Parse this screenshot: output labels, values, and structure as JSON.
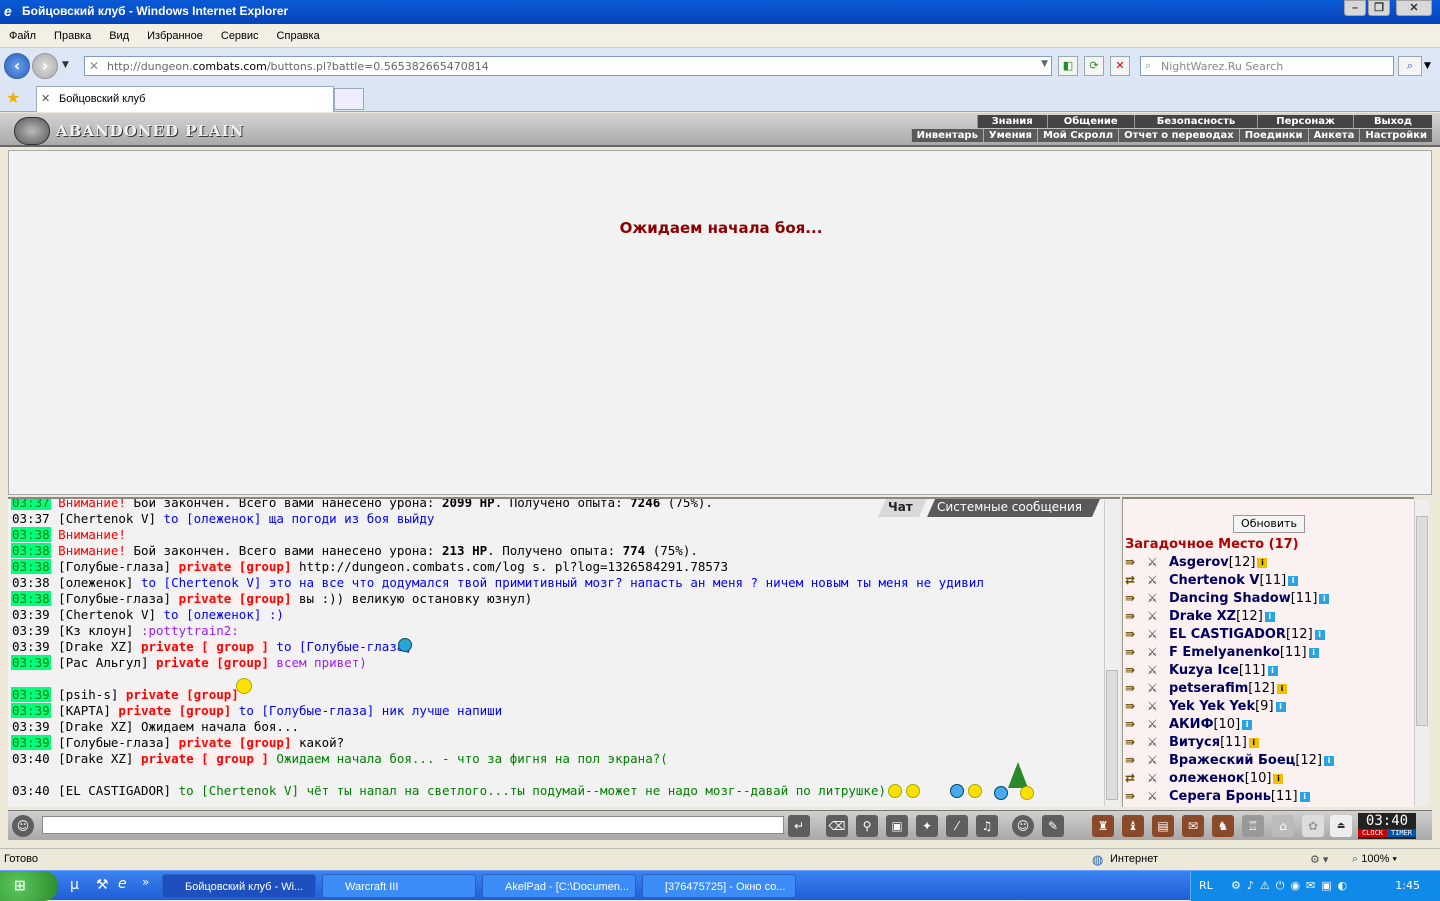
{
  "window": {
    "title": "Бойцовский клуб - Windows Internet Explorer",
    "controls": [
      "–",
      "❐",
      "✕"
    ]
  },
  "menu": [
    "Файл",
    "Правка",
    "Вид",
    "Избранное",
    "Сервис",
    "Справка"
  ],
  "address": {
    "url_prefix": "http://dungeon.",
    "url_domain": "combats.com",
    "url_suffix": "/buttons.pl?battle=0.565382665470814",
    "search_placeholder": "NightWarez.Ru Search"
  },
  "tabs": [
    {
      "label": "Бойцовский клуб"
    }
  ],
  "game": {
    "logo": "ABANDONED PLAIN",
    "top_menu": [
      "Знания",
      "Общение",
      "Безопасность",
      "Персонаж",
      "Выход"
    ],
    "sub_menu": [
      "Инвентарь",
      "Умения",
      "Мой Скролл",
      "Отчет о переводах",
      "Поединки",
      "Анкета",
      "Настройки"
    ],
    "waiting": "Ожидаем начала боя...",
    "chat_tabs": [
      "Чат",
      "Системные сообщения"
    ],
    "chat": [
      {
        "time": "03:37",
        "hl": true,
        "parts": [
          {
            "c": "wn",
            "t": "Внимание! "
          },
          {
            "c": "tx",
            "t": "Бой закончен. Всего вами нанесено урона: "
          },
          {
            "c": "tx b",
            "t": "2099 HP"
          },
          {
            "c": "tx",
            "t": ". Получено опыта: "
          },
          {
            "c": "tx b",
            "t": "7246"
          },
          {
            "c": "tx",
            "t": " (75%)."
          }
        ]
      },
      {
        "time": "03:37",
        "hl": false,
        "parts": [
          {
            "c": "nk",
            "t": "[Chertenok V] "
          },
          {
            "c": "to",
            "t": "to [олеженок] ща погоди из боя выйду"
          }
        ]
      },
      {
        "time": "03:38",
        "hl": true,
        "parts": [
          {
            "c": "wn",
            "t": "Внимание!"
          }
        ]
      },
      {
        "time": "03:38",
        "hl": true,
        "parts": [
          {
            "c": "wn",
            "t": "Внимание! "
          },
          {
            "c": "tx",
            "t": "Бой закончен. Всего вами нанесено урона: "
          },
          {
            "c": "tx b",
            "t": "213 HP"
          },
          {
            "c": "tx",
            "t": ". Получено опыта: "
          },
          {
            "c": "tx b",
            "t": "774"
          },
          {
            "c": "tx",
            "t": " (75%)."
          }
        ]
      },
      {
        "time": "03:38",
        "hl": true,
        "parts": [
          {
            "c": "nk",
            "t": "[Голубые-глаза] "
          },
          {
            "c": "pv",
            "t": "private [group]"
          },
          {
            "c": "tx",
            "t": " http://dungeon.combats.com/log s. pl?log=1326584291.78573"
          }
        ]
      },
      {
        "time": "03:38",
        "hl": false,
        "parts": [
          {
            "c": "nk",
            "t": "[олеженок] "
          },
          {
            "c": "to",
            "t": "to [Chertenok V] это на все что додумался твой примитивный мозг? напасть ан меня ? ничем новым ты меня не удивил"
          }
        ]
      },
      {
        "time": "03:38",
        "hl": true,
        "parts": [
          {
            "c": "nk",
            "t": "[Голубые-глаза] "
          },
          {
            "c": "pv",
            "t": "private [group]"
          },
          {
            "c": "tx",
            "t": " вы :)) великую остановку юзнул)"
          }
        ]
      },
      {
        "time": "03:39",
        "hl": false,
        "parts": [
          {
            "c": "nk",
            "t": "[Chertenok V] "
          },
          {
            "c": "to",
            "t": "to [олеженок] :)"
          }
        ]
      },
      {
        "time": "03:39",
        "hl": false,
        "parts": [
          {
            "c": "nk",
            "t": "[Кз клоун] "
          },
          {
            "c": "pu",
            "t": ":pottytrain2:"
          }
        ]
      },
      {
        "time": "03:39",
        "hl": false,
        "parts": [
          {
            "c": "nk",
            "t": "[Drake XZ] "
          },
          {
            "c": "pv",
            "t": "private [ group ]"
          },
          {
            "c": "to",
            "t": " to [Голубые-глаза]"
          }
        ]
      },
      {
        "time": "03:39",
        "hl": true,
        "parts": [
          {
            "c": "nk",
            "t": "[Рас Альгул] "
          },
          {
            "c": "pv",
            "t": "private [group]"
          },
          {
            "c": "pu",
            "t": " всем привет)"
          }
        ]
      },
      {
        "time": "",
        "hl": false,
        "parts": []
      },
      {
        "time": "03:39",
        "hl": true,
        "parts": [
          {
            "c": "nk",
            "t": "[psih-s] "
          },
          {
            "c": "pv",
            "t": "private [group]"
          }
        ]
      },
      {
        "time": "03:39",
        "hl": true,
        "parts": [
          {
            "c": "nk",
            "t": "[КАРТА] "
          },
          {
            "c": "pv",
            "t": "private [group]"
          },
          {
            "c": "to",
            "t": " to [Голубые-глаза] ник лучше напиши"
          }
        ]
      },
      {
        "time": "03:39",
        "hl": false,
        "parts": [
          {
            "c": "nk",
            "t": "[Drake XZ] "
          },
          {
            "c": "tx",
            "t": "Ожидаем начала боя..."
          }
        ]
      },
      {
        "time": "03:39",
        "hl": true,
        "parts": [
          {
            "c": "nk",
            "t": "[Голубые-глаза] "
          },
          {
            "c": "pv",
            "t": "private [group]"
          },
          {
            "c": "tx",
            "t": " какой?"
          }
        ]
      },
      {
        "time": "03:40",
        "hl": false,
        "parts": [
          {
            "c": "nk",
            "t": "[Drake XZ] "
          },
          {
            "c": "pv",
            "t": "private [ group ]"
          },
          {
            "c": "gr",
            "t": " Ожидаем начала боя... - что за фигня на пол экрана?("
          }
        ]
      },
      {
        "time": "",
        "hl": false,
        "parts": []
      },
      {
        "time": "03:40",
        "hl": false,
        "parts": [
          {
            "c": "nk",
            "t": "[EL CASTIGADOR] "
          },
          {
            "c": "gr",
            "t": "to [Chertenok V] чёт ты напал на светлого...ты подумай--может не надо мозг--давай по литрушке)"
          }
        ]
      }
    ],
    "refresh_label": "Обновить",
    "location": "Загадочное Место (17)",
    "users": [
      {
        "name": "Asgerov",
        "level": "[12]",
        "info": "y"
      },
      {
        "name": "Chertenok V",
        "level": "[11]",
        "info": "b"
      },
      {
        "name": "Dancing Shadow",
        "level": "[11]",
        "info": "b"
      },
      {
        "name": "Drake XZ",
        "level": "[12]",
        "info": "b"
      },
      {
        "name": "EL CASTIGADOR",
        "level": "[12]",
        "info": "b"
      },
      {
        "name": "F Emelyanenko",
        "level": "[11]",
        "info": "b"
      },
      {
        "name": "Kuzya Ice",
        "level": "[11]",
        "info": "b"
      },
      {
        "name": "petserafim",
        "level": "[12]",
        "info": "y"
      },
      {
        "name": "Yek Yek Yek",
        "level": "[9]",
        "info": "b"
      },
      {
        "name": "АКИФ",
        "level": "[10]",
        "info": "b"
      },
      {
        "name": "Витуся",
        "level": "[11]",
        "info": "y"
      },
      {
        "name": "Вражеский Боец",
        "level": "[12]",
        "info": "b"
      },
      {
        "name": "олеженок",
        "level": "[10]",
        "info": "y"
      },
      {
        "name": "Серега Бронь",
        "level": "[11]",
        "info": "b"
      }
    ],
    "clock": {
      "time": "03:40",
      "label1": "CLOCK",
      "label2": "TIMER"
    }
  },
  "status": {
    "left": "Готово",
    "zone": "Интернет",
    "zoom": "100%"
  },
  "taskbar": {
    "items": [
      "Бойцовский клуб - Wi...",
      "Warcraft III",
      "AkelPad - [C:\\Documen...",
      "[376475725] - Окно со..."
    ],
    "lang": "RL",
    "time": "1:45"
  }
}
